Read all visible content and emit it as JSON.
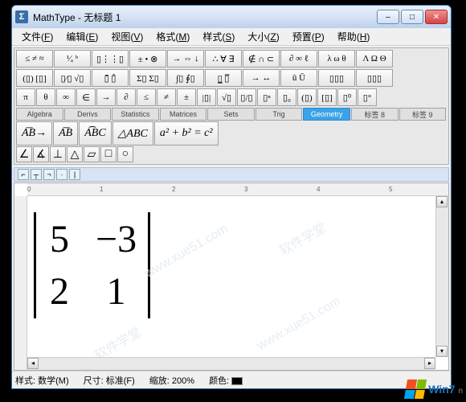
{
  "app_icon_text": "Σ",
  "window_title": "MathType - 无标题 1",
  "win_buttons": {
    "min": "–",
    "max": "□",
    "close": "✕"
  },
  "menu": [
    {
      "label": "文件",
      "key": "F"
    },
    {
      "label": "编辑",
      "key": "E"
    },
    {
      "label": "视图",
      "key": "V"
    },
    {
      "label": "格式",
      "key": "M"
    },
    {
      "label": "样式",
      "key": "S"
    },
    {
      "label": "大小",
      "key": "Z"
    },
    {
      "label": "预置",
      "key": "P"
    },
    {
      "label": "帮助",
      "key": "H"
    }
  ],
  "palette_row1": [
    "≤ ≠ ≈",
    "¹⁄ₐ ᵇ",
    "▯⋮⋮▯",
    "± • ⊗",
    "→ ⇔ ↓",
    "∴ ∀ ∃",
    "∉ ∩ ⊂",
    "∂ ∞ ℓ",
    "λ ω θ",
    "Λ Ω Θ"
  ],
  "palette_row2": [
    "(▯) [▯]",
    "▯⁄▯ √▯",
    "▯̄  ▯̂",
    "Σ▯ Σ▯",
    "∫▯ ∮▯",
    "▯̲  ▯̅",
    "→  ↔",
    "ū Ū",
    "▯▯▯",
    "▯▯▯"
  ],
  "palette_row3": [
    "π",
    "θ",
    "∞",
    "∈",
    "→",
    "∂",
    "≤",
    "≠",
    "±",
    "|▯|",
    "√▯",
    "▯/▯",
    "▯ⁿ",
    "▯₀",
    "(▯)",
    "[▯]",
    "▯⁰",
    "▯°"
  ],
  "tabs": [
    "Algebra",
    "Derivs",
    "Statistics",
    "Matrices",
    "Sets",
    "Trig",
    "Geometry",
    "标签 8",
    "标签 9"
  ],
  "active_tab_index": 6,
  "big_buttons": [
    "A͞B→",
    "A͞B",
    "A͡BC",
    "△ABC",
    "a² + b² = c²"
  ],
  "small_buttons": [
    "∠",
    "∡",
    "⊥",
    "△",
    "▱",
    "□",
    "○"
  ],
  "ruler_marks": [
    "0",
    "1",
    "2",
    "3",
    "4",
    "5"
  ],
  "chart_data": {
    "type": "matrix-determinant",
    "rows": 2,
    "cols": 2,
    "values": [
      [
        "5",
        "−3"
      ],
      [
        "2",
        "1"
      ]
    ]
  },
  "status": {
    "style_label": "样式:",
    "style_value": "数学(M)",
    "size_label": "尺寸:",
    "size_value": "标准(F)",
    "zoom_label": "缩放:",
    "zoom_value": "200%",
    "color_label": "颜色:"
  },
  "watermarks": [
    "www.xue51.com",
    "www.xue51.com",
    "软件学堂",
    "软件学堂"
  ],
  "logo_text": "Win7",
  "logo_sub": "n"
}
